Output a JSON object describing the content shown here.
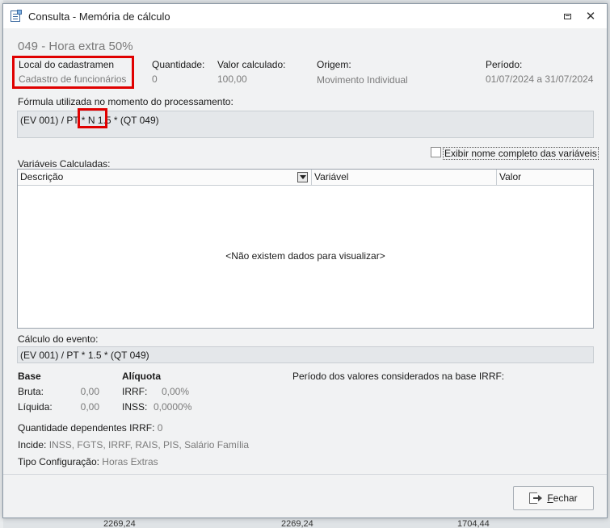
{
  "window": {
    "title": "Consulta - Memória de cálculo"
  },
  "header": {
    "event_title": "049 - Hora extra 50%"
  },
  "info": {
    "local": {
      "label": "Local do cadastramen",
      "value": "Cadastro de funcionários"
    },
    "quantidade": {
      "label": "Quantidade:",
      "value": "0"
    },
    "valor_calculado": {
      "label": "Valor calculado:",
      "value": "100,00"
    },
    "origem": {
      "label": "Origem:",
      "value": "Movimento Individual"
    },
    "periodo": {
      "label": "Período:",
      "value": "01/07/2024 a 31/07/2024"
    }
  },
  "formula": {
    "label": "Fórmula utilizada no momento do processamento:",
    "part1": "(EV 001) / PT * ",
    "highlight": "N 1.5",
    "part2": " * (QT 049)"
  },
  "options": {
    "show_full_names_label": "Exibir nome completo das variáveis",
    "show_full_names_checked": false
  },
  "variables": {
    "label": "Variáveis Calculadas:",
    "columns": [
      "Descrição",
      "Variável",
      "Valor"
    ],
    "empty_message": "<Não existem dados para visualizar>"
  },
  "calculo": {
    "label": "Cálculo do evento:",
    "value": "(EV 001) / PT * 1.5 * (QT 049)"
  },
  "base": {
    "heading": "Base",
    "bruta_label": "Bruta:",
    "bruta_value": "0,00",
    "liquida_label": "Líquida:",
    "liquida_value": "0,00"
  },
  "aliquota": {
    "heading": "Alíquota",
    "irrf_label": "IRRF:",
    "irrf_value": "0,00%",
    "inss_label": "INSS:",
    "inss_value": "0,0000%"
  },
  "periodo_irrf": {
    "label": "Período dos valores considerados na base IRRF:"
  },
  "dependentes": {
    "label": "Quantidade dependentes IRRF:",
    "value": "0"
  },
  "incide": {
    "label": "Incide:",
    "value": "INSS, FGTS, IRRF, RAIS, PIS, Salário Família"
  },
  "tipo": {
    "label": "Tipo Configuração:",
    "value": "Horas Extras"
  },
  "footer": {
    "close_label": "Fechar"
  },
  "background": {
    "cells": [
      "2269,24",
      "2269,24",
      "1704,44"
    ]
  },
  "colors": {
    "highlight": "#e00000",
    "panel": "#f1f2f3",
    "input_bg": "#e4e7ea"
  }
}
